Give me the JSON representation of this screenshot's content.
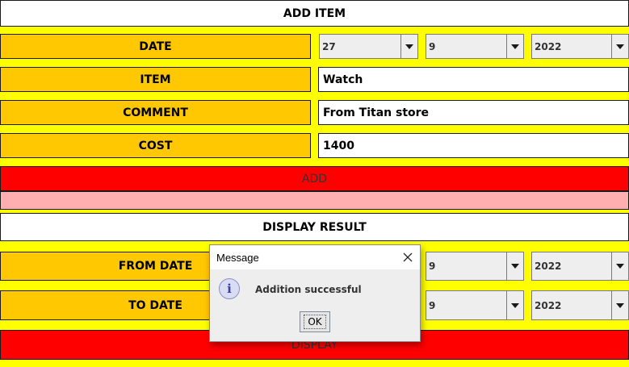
{
  "add_section": {
    "title": "ADD ITEM",
    "date_label": "DATE",
    "date_day": "27",
    "date_month": "9",
    "date_year": "2022",
    "item_label": "ITEM",
    "item_value": "Watch",
    "comment_label": "COMMENT",
    "comment_value": "From Titan store",
    "cost_label": "COST",
    "cost_value": "1400",
    "add_button": "ADD",
    "status_text": ""
  },
  "display_section": {
    "title": "DISPLAY RESULT",
    "from_label": "FROM DATE",
    "from_month": "9",
    "from_year": "2022",
    "to_label": "TO DATE",
    "to_month": "9",
    "to_year": "2022",
    "display_button": "DISPLAY"
  },
  "dialog": {
    "title": "Message",
    "message": "Addition successful",
    "ok_label": "OK",
    "icon": "information-icon"
  },
  "colors": {
    "background": "#ffff00",
    "label": "#ffc800",
    "button": "#ff0000",
    "status_bar": "#ffafaf"
  }
}
